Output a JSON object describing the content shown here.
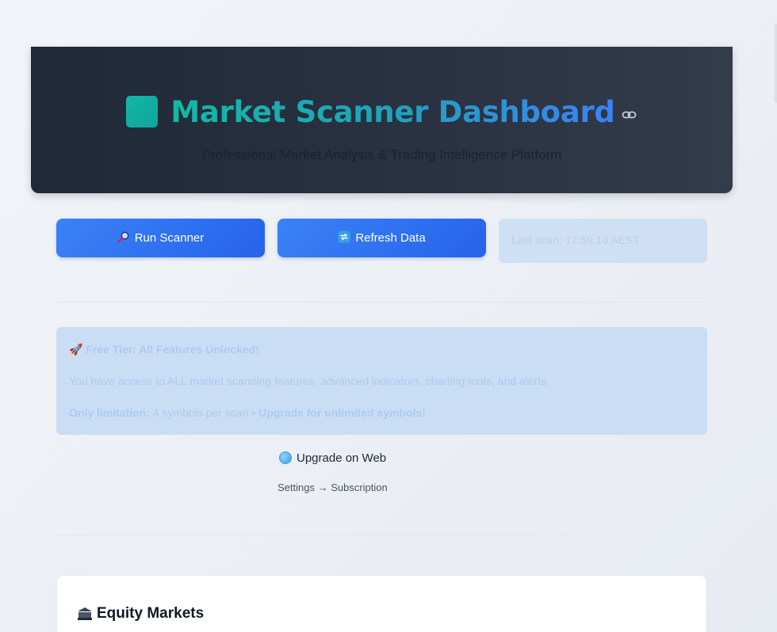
{
  "header": {
    "title": "Market Scanner Dashboard",
    "subtitle": "Professional Market Analysis & Trading Intelligence Platform",
    "logo_icon": "teal-square-icon",
    "anchor_icon": "link-icon"
  },
  "actions": {
    "run_scanner": {
      "icon": "magnifier-icon",
      "label": "Run Scanner"
    },
    "refresh_data": {
      "icon": "refresh-icon",
      "label": "Refresh Data"
    },
    "status": "Last scan: 17:59:10 AEST"
  },
  "banner": {
    "icon": "rocket-icon",
    "title": "Free Tier: All Features Unlocked!",
    "body": "You have access to ALL market scanning features, advanced indicators, charting tools, and alerts.",
    "limit_label": "Only limitation:",
    "limit_text": " 4 symbols per scan • ",
    "limit_cta": "Upgrade for unlimited symbols!"
  },
  "upgrade": {
    "icon": "globe-icon",
    "label": "Upgrade on Web",
    "path": "Settings → Subscription"
  },
  "sections": {
    "equity": {
      "icon": "bank-icon",
      "title": "Equity Markets"
    }
  },
  "colors": {
    "primary": "#2563eb",
    "accent": "#14b8a6",
    "header_bg": "#1f2937"
  }
}
